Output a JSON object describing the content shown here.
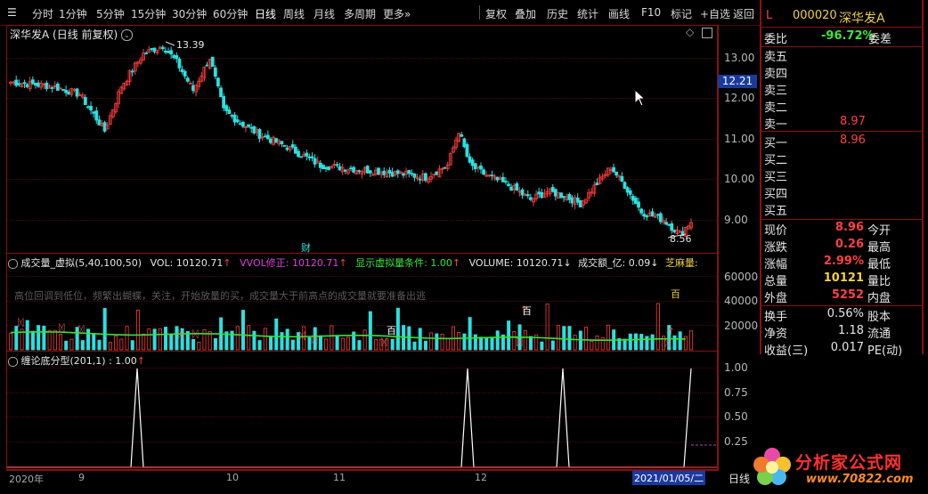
{
  "toolbar": {
    "left": [
      "分时",
      "1分钟",
      "5分钟",
      "15分钟",
      "30分钟",
      "60分钟",
      "日线",
      "周线",
      "月线",
      "多周期",
      "更多»"
    ],
    "right": [
      "复权",
      "叠加",
      "历史",
      "统计",
      "画线",
      "F10",
      "标记",
      "+自选",
      "返回"
    ]
  },
  "main_chart": {
    "title": "深华发A (日线 前复权)",
    "y_labels": [
      "13.00",
      "12.00",
      "11.00",
      "10.00",
      "9.00"
    ],
    "current_price_tag": "12.21",
    "high_marker": "13.39",
    "low_marker": "8.56",
    "event_marker": "财"
  },
  "volume_panel": {
    "indicator_name": "成交量_虚拟(5,40,100,50)",
    "vol_label": "VOL: 10120.71",
    "vol_corr_label": "VVOL修正: 10120.71",
    "cond_label": "显示虚拟量条件: 1.00",
    "volume_label": "VOLUME: 10120.71",
    "amount_label": "成交额_亿: 0.09",
    "sesame_label": "芝麻量:",
    "note": "高位回调到低位，频繁出蝴蝶，关注，开始放量的买，成交量大于前高点的成交量就要准备出逃",
    "y_labels": [
      "60000",
      "40000",
      "20000"
    ],
    "markers": [
      "百",
      "百",
      "百"
    ]
  },
  "fractal_panel": {
    "indicator_name": "缠论底分型(201,1) : 1.00",
    "y_labels": [
      "1.00",
      "0.75",
      "0.50",
      "0.25"
    ]
  },
  "time_axis": {
    "labels": [
      "2020年",
      "9",
      "10",
      "11",
      "12"
    ],
    "cursor_date": "2021/01/05/二",
    "period": "日线"
  },
  "right_panel": {
    "level": "L",
    "code": "000020",
    "name": "深华发A",
    "weibi_label": "委比",
    "weibi_value": "-96.72%",
    "weicha_label": "委差",
    "sell_levels": [
      {
        "label": "卖五",
        "price": ""
      },
      {
        "label": "卖四",
        "price": ""
      },
      {
        "label": "卖三",
        "price": ""
      },
      {
        "label": "卖二",
        "price": ""
      },
      {
        "label": "卖一",
        "price": "8.97"
      }
    ],
    "buy_levels": [
      {
        "label": "买一",
        "price": "8.96"
      },
      {
        "label": "买二",
        "price": ""
      },
      {
        "label": "买三",
        "price": ""
      },
      {
        "label": "买四",
        "price": ""
      },
      {
        "label": "买五",
        "price": ""
      }
    ],
    "quote_rows": [
      {
        "l1": "现价",
        "v1": "8.96",
        "l2": "今开",
        "c": "red"
      },
      {
        "l1": "涨跌",
        "v1": "0.26",
        "l2": "最高",
        "c": "red"
      },
      {
        "l1": "涨幅",
        "v1": "2.99%",
        "l2": "最低",
        "c": "red"
      },
      {
        "l1": "总量",
        "v1": "10121",
        "l2": "量比",
        "c": "yellow"
      },
      {
        "l1": "外盘",
        "v1": "5252",
        "l2": "内盘",
        "c": "red"
      }
    ],
    "stat_rows": [
      {
        "l1": "换手",
        "v1": "0.56%",
        "l2": "股本"
      },
      {
        "l1": "净资",
        "v1": "1.18",
        "l2": "流通"
      },
      {
        "l1": "收益(三)",
        "v1": "0.017",
        "l2": "PE(动)"
      }
    ]
  },
  "watermark": {
    "title": "分析家公式网",
    "url": "www.70822.com"
  },
  "colors": {
    "up": "#ff3c3c",
    "down": "#2be0e0",
    "frame": "#8b1010",
    "ma": "#35e535"
  }
}
